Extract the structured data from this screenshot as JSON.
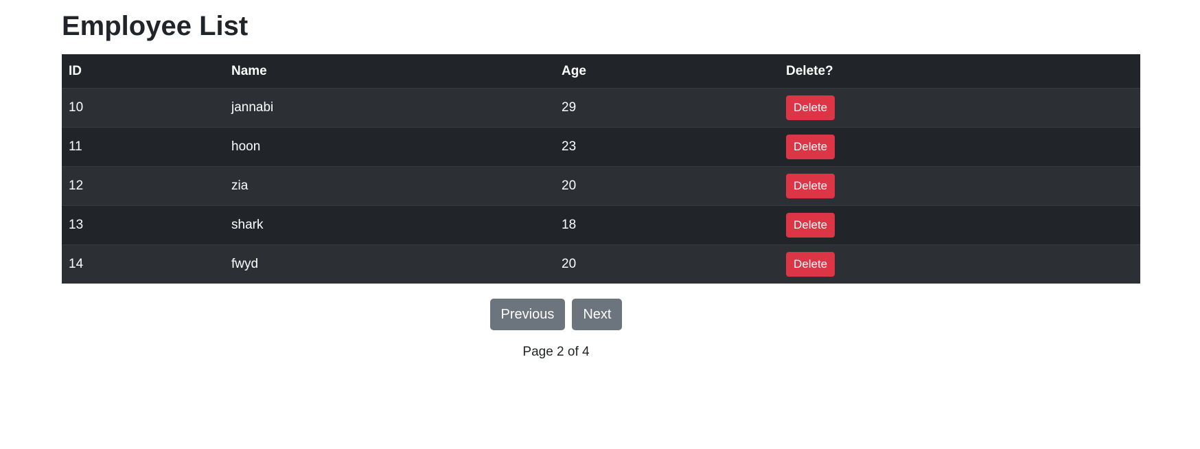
{
  "page": {
    "title": "Employee List"
  },
  "table": {
    "headers": {
      "id": "ID",
      "name": "Name",
      "age": "Age",
      "delete": "Delete?"
    },
    "rows": [
      {
        "id": "10",
        "name": "jannabi",
        "age": "29",
        "action": "Delete"
      },
      {
        "id": "11",
        "name": "hoon",
        "age": "23",
        "action": "Delete"
      },
      {
        "id": "12",
        "name": "zia",
        "age": "20",
        "action": "Delete"
      },
      {
        "id": "13",
        "name": "shark",
        "age": "18",
        "action": "Delete"
      },
      {
        "id": "14",
        "name": "fwyd",
        "age": "20",
        "action": "Delete"
      }
    ]
  },
  "pagination": {
    "previous_label": "Previous",
    "next_label": "Next",
    "status": "Page 2 of 4"
  },
  "colors": {
    "table_bg": "#212529",
    "table_stripe": "#2c3034",
    "danger": "#dc3545",
    "secondary": "#6c757d"
  }
}
